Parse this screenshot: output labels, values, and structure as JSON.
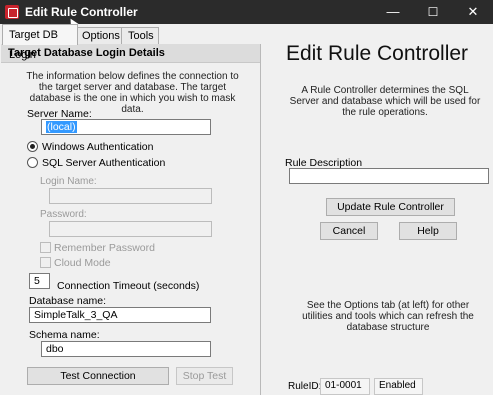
{
  "window": {
    "title": "Edit Rule Controller",
    "controls": {
      "minimize": "—",
      "maximize": "☐",
      "close": "✕"
    }
  },
  "tabs": [
    {
      "label": "Target DB Login",
      "active": true
    },
    {
      "label": "Options",
      "active": false
    },
    {
      "label": "Tools",
      "active": false
    }
  ],
  "left": {
    "section_title": "Target Database Login Details",
    "description": "The information below defines the connection to the target server and database. The target database is the one in which you wish to mask data.",
    "server_name_label": "Server Name:",
    "server_name_value": "(local)",
    "auth": {
      "windows_label": "Windows Authentication",
      "sql_label": "SQL Server Authentication",
      "selected": "windows"
    },
    "login_name_label": "Login Name:",
    "login_name_value": "",
    "password_label": "Password:",
    "password_value": "",
    "remember_password_label": "Remember Password",
    "cloud_mode_label": "Cloud Mode",
    "timeout_value": "5",
    "timeout_label": "Connection Timeout (seconds)",
    "database_name_label": "Database name:",
    "database_name_value": "SimpleTalk_3_QA",
    "schema_name_label": "Schema name:",
    "schema_name_value": "dbo",
    "test_connection_label": "Test Connection",
    "stop_test_label": "Stop Test"
  },
  "right": {
    "heading": "Edit Rule Controller",
    "description": "A Rule Controller determines the SQL Server and database which will be used for the rule operations.",
    "rule_description_label": "Rule Description",
    "rule_description_value": "",
    "update_button_label": "Update Rule Controller",
    "cancel_button_label": "Cancel",
    "help_button_label": "Help",
    "info_text": "See the Options tab (at left) for other utilities and tools which can refresh the database structure",
    "rule_id_label": "RuleID:",
    "rule_id_value": "01-0001",
    "status_value": "Enabled"
  },
  "colors": {
    "titlebar_bg": "#2b2b2b",
    "app_icon": "#c8232c",
    "selection": "#3399ff"
  }
}
